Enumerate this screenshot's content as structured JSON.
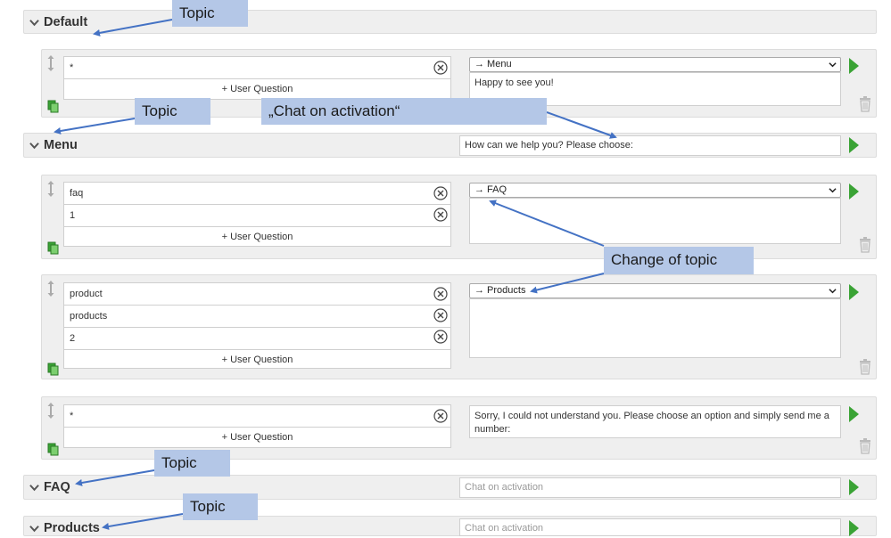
{
  "topics": {
    "default": {
      "title": "Default"
    },
    "menu": {
      "title": "Menu",
      "activation_value": "How can we help you? Please choose:"
    },
    "faq": {
      "title": "FAQ",
      "activation_placeholder": "Chat on activation"
    },
    "products": {
      "title": "Products",
      "activation_placeholder": "Chat on activation"
    }
  },
  "rules": {
    "default_1": {
      "questions": [
        "*"
      ],
      "add_label": "+ User Question",
      "target": "→ Menu",
      "response": "Happy to see you!"
    },
    "menu_1": {
      "questions": [
        "faq",
        "1"
      ],
      "add_label": "+ User Question",
      "target": "→ FAQ",
      "response": ""
    },
    "menu_2": {
      "questions": [
        "product",
        "products",
        "2"
      ],
      "add_label": "+ User Question",
      "target": "→ Products",
      "response": ""
    },
    "menu_3": {
      "questions": [
        "*"
      ],
      "add_label": "+ User Question",
      "target": "",
      "response": "Sorry, I could not understand you. Please choose an option and simply send me a number:"
    }
  },
  "annotations": {
    "topic": "Topic",
    "chat_on_activation": "„Chat on activation“",
    "change_of_topic": "Change of topic"
  },
  "colors": {
    "accent_green": "#3aa335",
    "callout_bg": "#b4c7e7",
    "arrow": "#4472c4"
  }
}
